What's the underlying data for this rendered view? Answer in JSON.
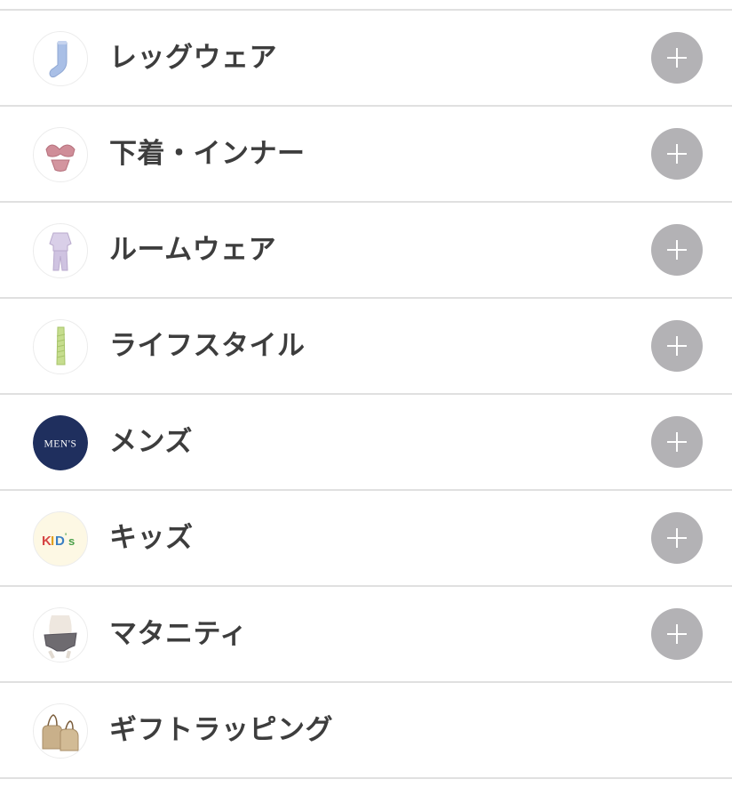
{
  "categories": [
    {
      "label": "レッグウェア",
      "icon": "socks-icon",
      "expandable": true
    },
    {
      "label": "下着・インナー",
      "icon": "bra-icon",
      "expandable": true
    },
    {
      "label": "ルームウェア",
      "icon": "pajamas-icon",
      "expandable": true
    },
    {
      "label": "ライフスタイル",
      "icon": "leg-warmer-icon",
      "expandable": true
    },
    {
      "label": "メンズ",
      "icon": "mens-logo-icon",
      "badge_text": "MEN'S",
      "badge_color": "#1f2f5e",
      "expandable": true
    },
    {
      "label": "キッズ",
      "icon": "kids-logo-icon",
      "badge_text": "KID's",
      "badge_bg": "#fdf8e4",
      "expandable": true
    },
    {
      "label": "マタニティ",
      "icon": "maternity-shorts-icon",
      "expandable": true
    },
    {
      "label": "ギフトラッピング",
      "icon": "gift-bag-icon",
      "expandable": false
    }
  ],
  "colors": {
    "plus_button": "#b3b2b5",
    "label_text": "#3d3d3d",
    "divider": "#e0e0e0"
  }
}
